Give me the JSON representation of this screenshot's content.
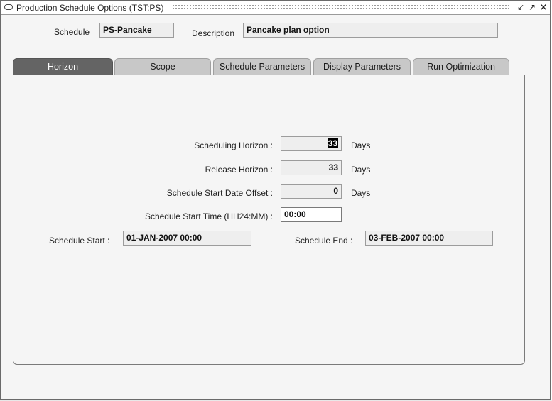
{
  "window": {
    "title": "Production Schedule Options (TST:PS)",
    "controls": [
      "minimize-to-corner",
      "maximize",
      "close"
    ]
  },
  "header": {
    "schedule_label": "Schedule",
    "schedule_value": "PS-Pancake",
    "description_label": "Description",
    "description_value": "Pancake plan option"
  },
  "tabs": [
    {
      "label": "Horizon",
      "active": true
    },
    {
      "label": "Scope",
      "active": false
    },
    {
      "label": "Schedule Parameters",
      "active": false
    },
    {
      "label": "Display Parameters",
      "active": false
    },
    {
      "label": "Run Optimization",
      "active": false
    }
  ],
  "horizon": {
    "scheduling_horizon_label": "Scheduling Horizon :",
    "scheduling_horizon_value": "33",
    "scheduling_horizon_unit": "Days",
    "release_horizon_label": "Release Horizon :",
    "release_horizon_value": "33",
    "release_horizon_unit": "Days",
    "start_offset_label": "Schedule Start Date Offset :",
    "start_offset_value": "0",
    "start_offset_unit": "Days",
    "start_time_label": "Schedule Start Time (HH24:MM) :",
    "start_time_value": "00:00",
    "schedule_start_label": "Schedule Start :",
    "schedule_start_value": "01-JAN-2007  00:00",
    "schedule_end_label": "Schedule End :",
    "schedule_end_value": "03-FEB-2007  00:00"
  }
}
